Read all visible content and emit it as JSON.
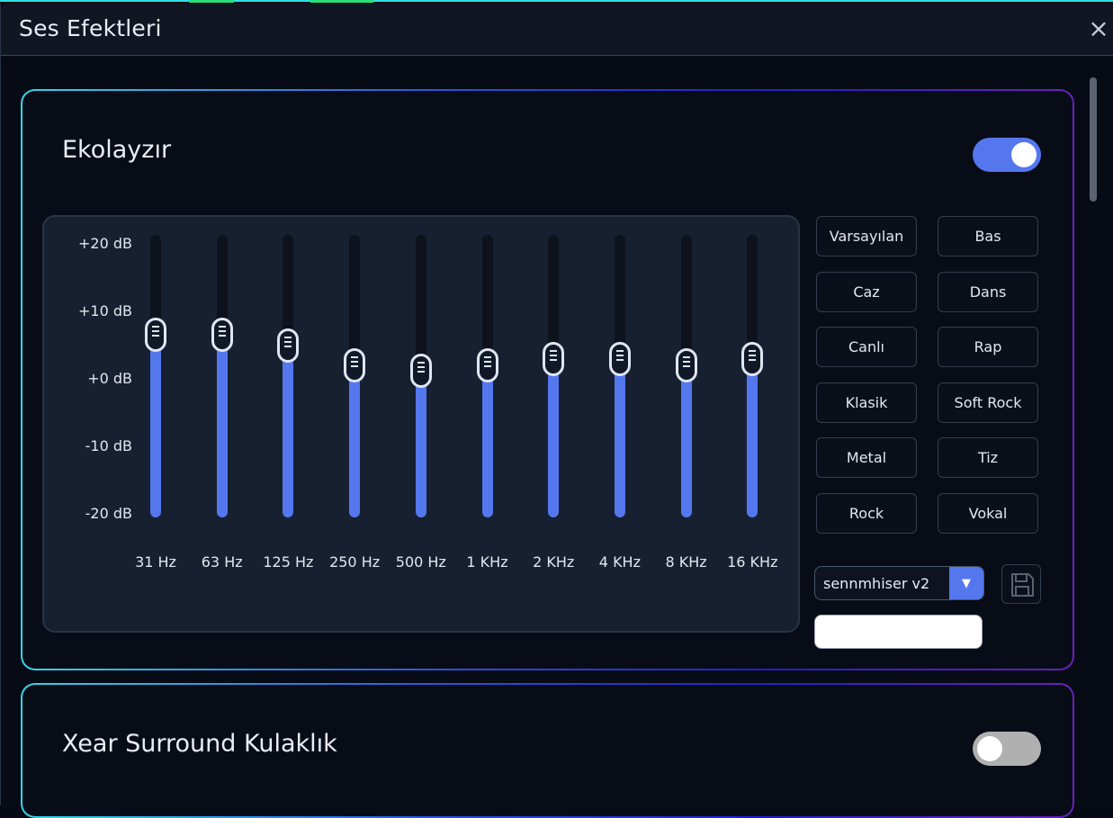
{
  "window": {
    "title": "Ses Efektleri",
    "close_icon": "×"
  },
  "equalizer": {
    "title": "Ekolayzır",
    "enabled": true,
    "db_labels": [
      "+20 dB",
      "+10 dB",
      "+0 dB",
      "-10 dB",
      "-20 dB"
    ],
    "db_range": [
      -20,
      20
    ],
    "bands": [
      {
        "label": "31 Hz",
        "gain_db": 6.7
      },
      {
        "label": "63 Hz",
        "gain_db": 6.7
      },
      {
        "label": "125 Hz",
        "gain_db": 5.0
      },
      {
        "label": "250 Hz",
        "gain_db": 1.8
      },
      {
        "label": "500 Hz",
        "gain_db": 0.9
      },
      {
        "label": "1 KHz",
        "gain_db": 1.8
      },
      {
        "label": "2 KHz",
        "gain_db": 2.7
      },
      {
        "label": "4 KHz",
        "gain_db": 2.7
      },
      {
        "label": "8 KHz",
        "gain_db": 1.8
      },
      {
        "label": "16 KHz",
        "gain_db": 2.7
      }
    ],
    "presets": [
      "Varsayılan",
      "Bas",
      "Caz",
      "Dans",
      "Canlı",
      "Rap",
      "Klasik",
      "Soft Rock",
      "Metal",
      "Tiz",
      "Rock",
      "Vokal"
    ],
    "profile_select": {
      "value": "sennmhiser v2",
      "arrow_icon": "▼"
    },
    "save_icon": "floppy-disk-icon",
    "name_input": {
      "value": ""
    }
  },
  "xear": {
    "title": "Xear Surround Kulaklık",
    "enabled": false
  },
  "colors": {
    "accent": "#5577ee",
    "panel": "#172030",
    "background": "#080c17"
  }
}
